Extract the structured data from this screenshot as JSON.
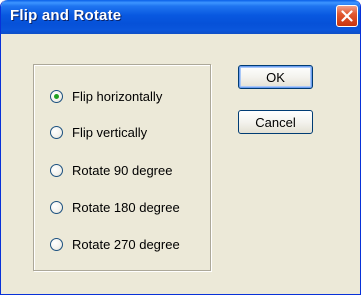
{
  "dialog": {
    "title": "Flip and Rotate",
    "accent_color": "#0a56dc",
    "close_icon": "close-icon"
  },
  "options": {
    "selected_index": 0,
    "items": [
      {
        "label": "Flip horizontally",
        "checked": true
      },
      {
        "label": "Flip vertically",
        "checked": false
      },
      {
        "label": "Rotate 90 degree",
        "checked": false
      },
      {
        "label": "Rotate 180 degree",
        "checked": false
      },
      {
        "label": "Rotate 270 degree",
        "checked": false
      }
    ]
  },
  "buttons": {
    "ok_label": "OK",
    "cancel_label": "Cancel"
  }
}
